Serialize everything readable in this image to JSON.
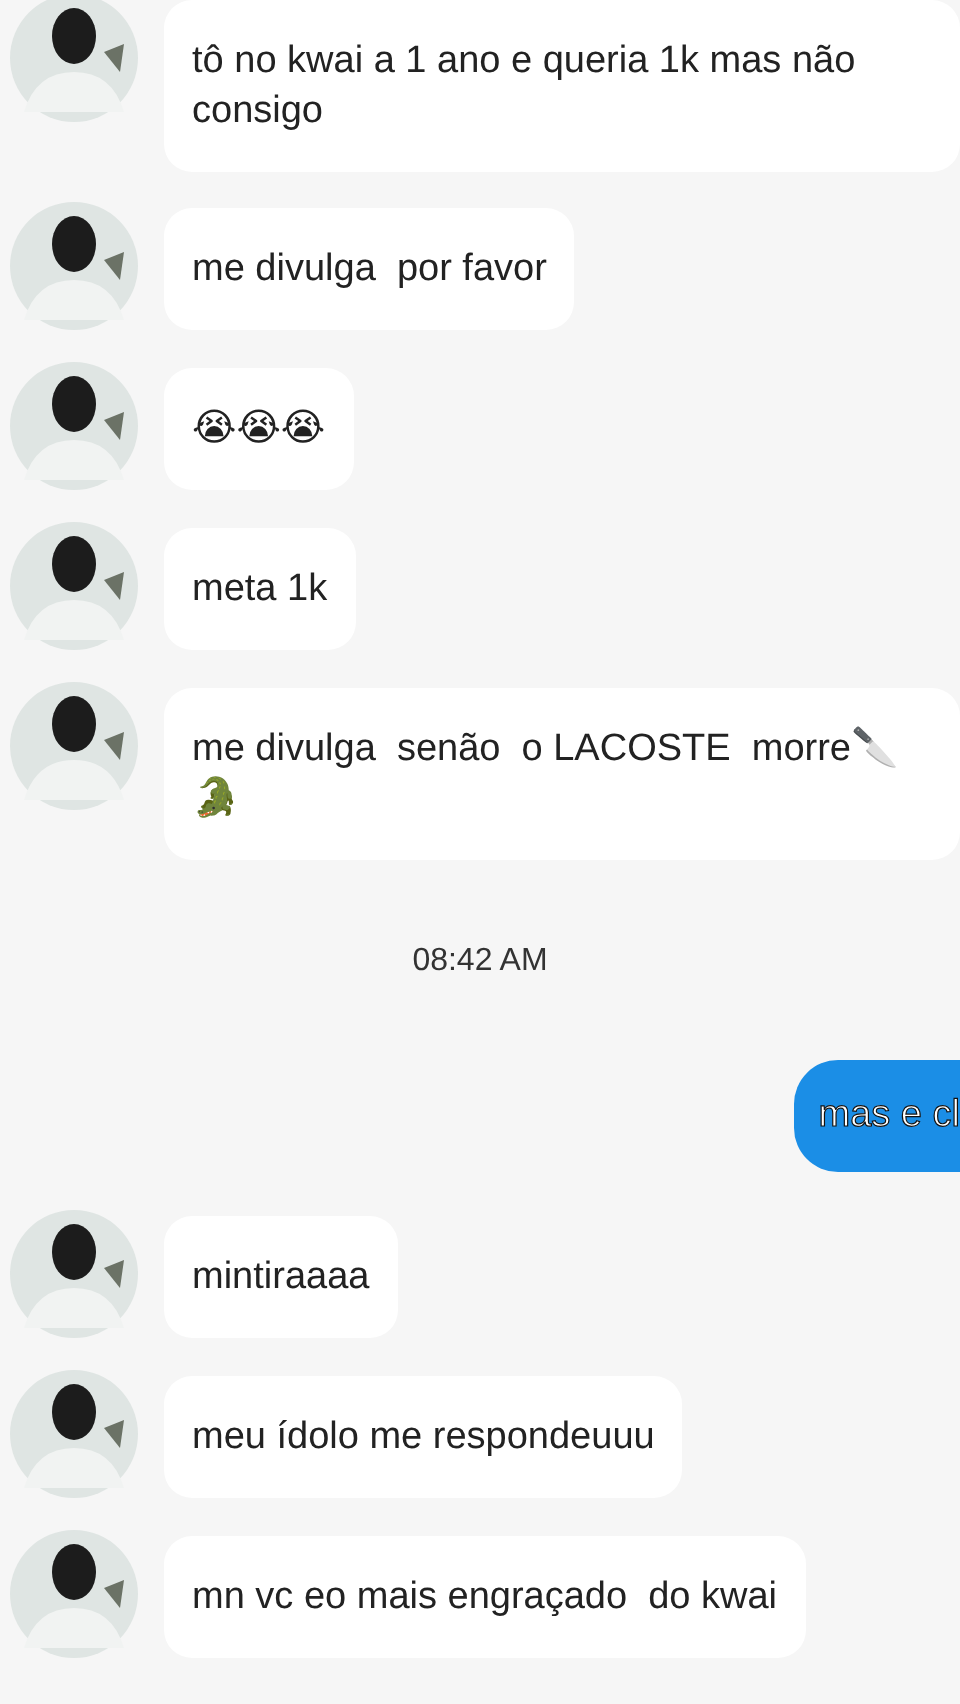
{
  "messages": [
    {
      "kind": "incoming",
      "text": "tô no kwai a 1 ano e queria 1k mas não consigo"
    },
    {
      "kind": "incoming",
      "text": "me divulga  por favor"
    },
    {
      "kind": "incoming",
      "text": "😭😭😭"
    },
    {
      "kind": "incoming",
      "text": "meta 1k"
    },
    {
      "kind": "incoming",
      "text": "me divulga  senão  o LACOSTE  morre🔪 🐊"
    },
    {
      "kind": "time",
      "text": "08:42 AM"
    },
    {
      "kind": "outgoing",
      "text": "mas e cl"
    },
    {
      "kind": "incoming",
      "text": "mintiraaaa"
    },
    {
      "kind": "incoming",
      "text": "meu ídolo me respondeuuu"
    },
    {
      "kind": "incoming",
      "text": "mn vc eo mais engraçado  do kwai"
    }
  ]
}
